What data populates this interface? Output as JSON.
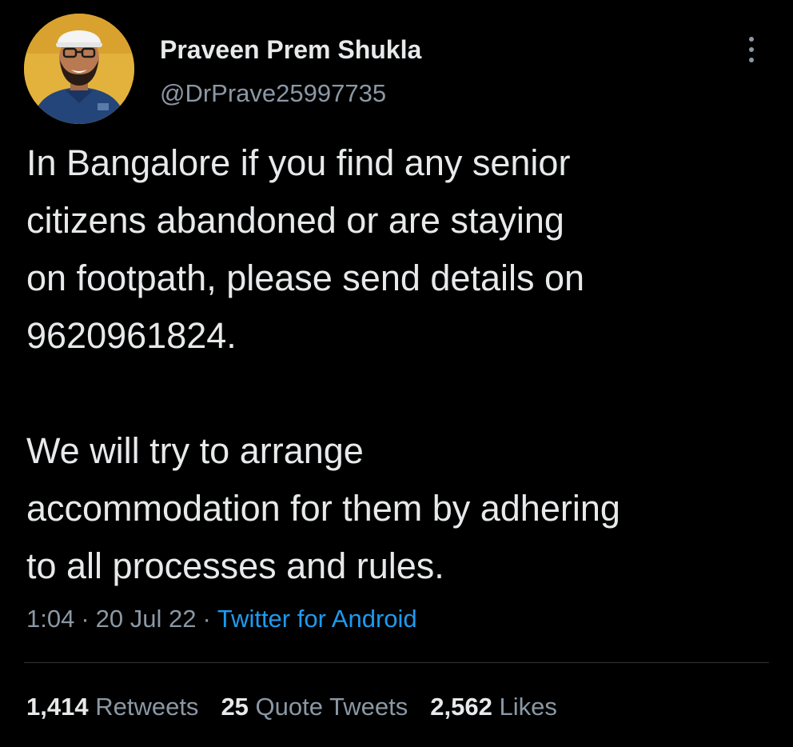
{
  "user": {
    "display_name": "Praveen Prem Shukla",
    "handle": "@DrPrave25997735"
  },
  "menu_icon": "more-vertical-icon",
  "tweet": {
    "paragraphs": [
      "In Bangalore if you find any senior\ncitizens abandoned or are staying\non footpath, please send details on\n9620961824.",
      "We will try to arrange\naccommodation for them by adhering\nto all processes and rules."
    ],
    "time": "1:04",
    "date": "20 Jul 22",
    "source": "Twitter for Android"
  },
  "stats": {
    "retweets_count": "1,414",
    "retweets_label": "Retweets",
    "quotes_count": "25",
    "quotes_label": "Quote Tweets",
    "likes_count": "2,562",
    "likes_label": "Likes"
  },
  "colors": {
    "background": "#000000",
    "text": "#e7e9ea",
    "secondary": "#8b98a5",
    "link": "#1d9bf0",
    "divider": "#2f3336"
  }
}
